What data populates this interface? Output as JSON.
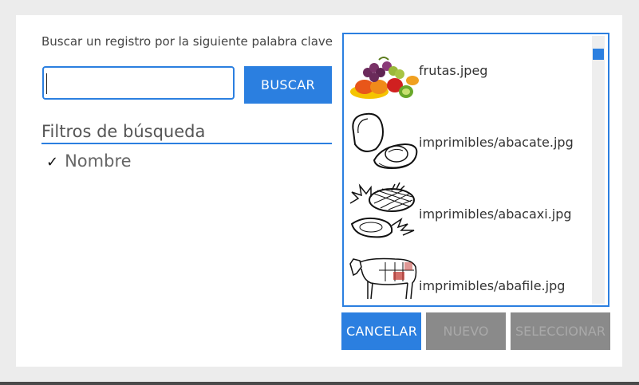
{
  "search": {
    "prompt": "Buscar un registro por la siguiente palabra clave",
    "value": "",
    "button_label": "BUSCAR"
  },
  "filters": {
    "title": "Filtros de búsqueda",
    "items": [
      {
        "label": "Nombre",
        "checked": true
      }
    ]
  },
  "results": {
    "items": [
      {
        "label": "frutas.jpeg",
        "icon": "fruit-bowl-icon"
      },
      {
        "label": "imprimibles/abacate.jpg",
        "icon": "avocado-drawing-icon"
      },
      {
        "label": "imprimibles/abacaxi.jpg",
        "icon": "pineapple-drawing-icon"
      },
      {
        "label": "imprimibles/abafile.jpg",
        "icon": "cow-drawing-icon"
      }
    ],
    "scroll_position": 0
  },
  "actions": {
    "cancel_label": "CANCELAR",
    "new_label": "NUEVO",
    "select_label": "SELECCIONAR"
  },
  "colors": {
    "accent": "#2b7fe0",
    "disabled": "#8a8a8a",
    "background": "#ececec"
  }
}
